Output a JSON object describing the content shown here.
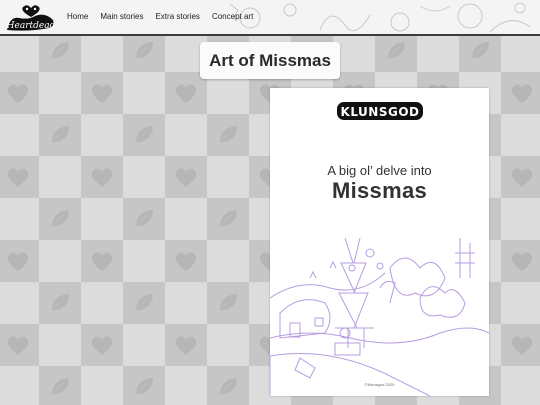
{
  "site": {
    "logo_text": "Heartdead",
    "logo_icon": "heart-eyes-logo"
  },
  "nav": {
    "items": [
      {
        "label": "Home"
      },
      {
        "label": "Main stories"
      },
      {
        "label": "Extra stories"
      },
      {
        "label": "Concept art"
      }
    ]
  },
  "page": {
    "title": "Art of Missmas"
  },
  "cover": {
    "brand": "KLUNSGOD",
    "subtitle": "A big ol’ delve into",
    "title": "Missmas",
    "copyright": "©Klunsgod 2020",
    "art_color": "#b79de0"
  },
  "colors": {
    "tile_light": "#dcdcdc",
    "tile_dark": "#c6c6c6",
    "nav_bg": "#f4f4f4",
    "nav_border": "#3a3a3a"
  },
  "icons": [
    "heart-icon",
    "leaf-icon"
  ]
}
